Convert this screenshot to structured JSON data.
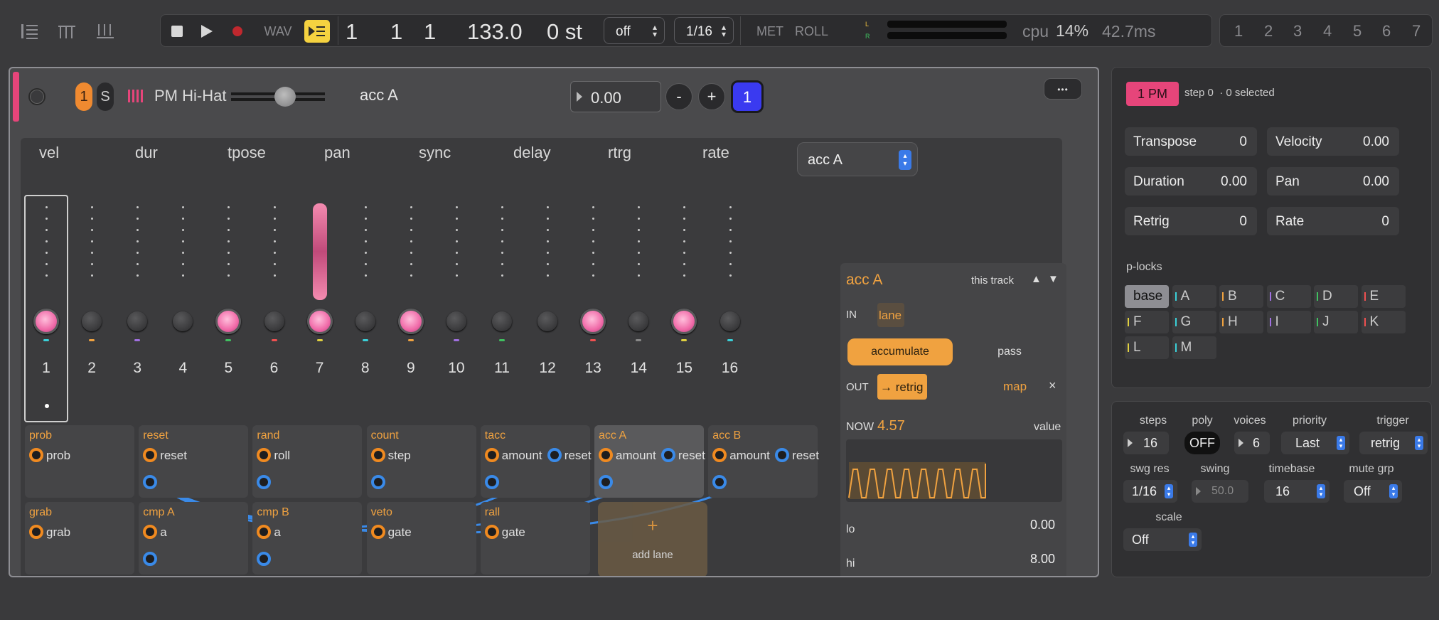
{
  "transport": {
    "wav": "WAV",
    "bar": "1",
    "beat": "1",
    "tick": "1",
    "tempo": "133.0",
    "transpose": "0 st",
    "swing_select": "off",
    "grid_select": "1/16",
    "met": "MET",
    "roll": "ROLL",
    "meter_l": "L",
    "meter_r": "R",
    "cpu_label": "cpu",
    "cpu_value": "14%",
    "latency": "42.7ms"
  },
  "patterns": [
    "1",
    "2",
    "3",
    "4",
    "5",
    "6",
    "7"
  ],
  "track": {
    "number": "1",
    "solo": "S",
    "name": "PM Hi-Hat",
    "selected_lane": "acc A",
    "value": "0.00",
    "minus": "-",
    "plus": "+",
    "page": "1",
    "more": "•••",
    "slider_level": 0.6
  },
  "lane_headers": [
    "vel",
    "dur",
    "tpose",
    "pan",
    "sync",
    "delay",
    "rtrg",
    "rate"
  ],
  "lane_select": "acc A",
  "steps": [
    {
      "n": "1",
      "on": true,
      "color": "#3ad0d8"
    },
    {
      "n": "2",
      "on": false,
      "color": "#f0a240"
    },
    {
      "n": "3",
      "on": false,
      "color": "#a070e0"
    },
    {
      "n": "4",
      "on": false,
      "color": ""
    },
    {
      "n": "5",
      "on": true,
      "color": "#40c060"
    },
    {
      "n": "6",
      "on": false,
      "color": "#f05050"
    },
    {
      "n": "7",
      "on": true,
      "color": "#e0d040"
    },
    {
      "n": "8",
      "on": false,
      "color": "#3ad0d8"
    },
    {
      "n": "9",
      "on": true,
      "color": "#f0a240"
    },
    {
      "n": "10",
      "on": false,
      "color": "#a070e0"
    },
    {
      "n": "11",
      "on": false,
      "color": "#40c060"
    },
    {
      "n": "12",
      "on": false,
      "color": ""
    },
    {
      "n": "13",
      "on": true,
      "color": "#f05050"
    },
    {
      "n": "14",
      "on": false,
      "color": "#888888"
    },
    {
      "n": "15",
      "on": true,
      "color": "#e0d040"
    },
    {
      "n": "16",
      "on": false,
      "color": "#3ad0d8"
    }
  ],
  "pan_level": 1.0,
  "lanes_row1": [
    {
      "title": "prob",
      "ports": [
        "prob"
      ],
      "out": false
    },
    {
      "title": "reset",
      "ports": [
        "reset"
      ],
      "out": true
    },
    {
      "title": "rand",
      "ports": [
        "roll"
      ],
      "out": true
    },
    {
      "title": "count",
      "ports": [
        "step"
      ],
      "out": true
    },
    {
      "title": "tacc",
      "ports": [
        "amount",
        "reset"
      ],
      "out": true
    },
    {
      "title": "acc A",
      "ports": [
        "amount",
        "reset"
      ],
      "out": true
    },
    {
      "title": "acc B",
      "ports": [
        "amount",
        "reset"
      ],
      "out": true
    }
  ],
  "lanes_row2": [
    {
      "title": "grab",
      "ports": [
        "grab"
      ],
      "out": false
    },
    {
      "title": "cmp A",
      "ports": [
        "a"
      ],
      "out": true
    },
    {
      "title": "cmp B",
      "ports": [
        "a"
      ],
      "out": true
    },
    {
      "title": "veto",
      "ports": [
        "gate"
      ],
      "out": false
    },
    {
      "title": "rall",
      "ports": [
        "gate"
      ],
      "out": false
    }
  ],
  "add_lane": {
    "plus": "+",
    "label": "add lane"
  },
  "modulator": {
    "title": "acc A",
    "scope": "this track",
    "in_label": "IN",
    "in_value": "lane",
    "mode_on": "accumulate",
    "mode_off": "pass",
    "out_label": "OUT",
    "out_value": "→ retrig",
    "map": "map",
    "close": "×",
    "now_label": "NOW",
    "now_value": "4.57",
    "value_label": "value",
    "lo_label": "lo",
    "lo_value": "0.00",
    "hi_label": "hi",
    "hi_value": "8.00"
  },
  "inspector": {
    "badge": "1 PM",
    "status": "step 0  · 0 selected",
    "fields": [
      {
        "label": "Transpose",
        "value": "0"
      },
      {
        "label": "Velocity",
        "value": "0.00"
      },
      {
        "label": "Duration",
        "value": "0.00"
      },
      {
        "label": "Pan",
        "value": "0.00"
      },
      {
        "label": "Retrig",
        "value": "0"
      },
      {
        "label": "Rate",
        "value": "0"
      }
    ],
    "plocks_label": "p-locks",
    "plocks": [
      {
        "name": "base",
        "color": ""
      },
      {
        "name": "A",
        "color": "#3ad0d8"
      },
      {
        "name": "B",
        "color": "#f0a240"
      },
      {
        "name": "C",
        "color": "#a070e0"
      },
      {
        "name": "D",
        "color": "#40c060"
      },
      {
        "name": "E",
        "color": "#f05050"
      },
      {
        "name": "F",
        "color": "#e0d040"
      },
      {
        "name": "G",
        "color": "#3ad0d8"
      },
      {
        "name": "H",
        "color": "#f0a240"
      },
      {
        "name": "I",
        "color": "#a070e0"
      },
      {
        "name": "J",
        "color": "#40c060"
      },
      {
        "name": "K",
        "color": "#f05050"
      },
      {
        "name": "L",
        "color": "#e0d040"
      },
      {
        "name": "M",
        "color": "#3ad0d8"
      }
    ]
  },
  "settings": {
    "steps_label": "steps",
    "steps": "16",
    "poly_label": "poly",
    "poly": "OFF",
    "voices_label": "voices",
    "voices": "6",
    "priority_label": "priority",
    "priority": "Last",
    "trigger_label": "trigger",
    "trigger": "retrig",
    "swgres_label": "swg res",
    "swgres": "1/16",
    "swing_label": "swing",
    "swing": "50.0",
    "timebase_label": "timebase",
    "timebase": "16",
    "mutegrp_label": "mute grp",
    "mutegrp": "Off",
    "scale_label": "scale",
    "scale": "Off"
  },
  "colors": {
    "accent": "#f0a240",
    "pink": "#e6457a",
    "blue": "#3a8ae8",
    "page_blue": "#3a3af0"
  }
}
